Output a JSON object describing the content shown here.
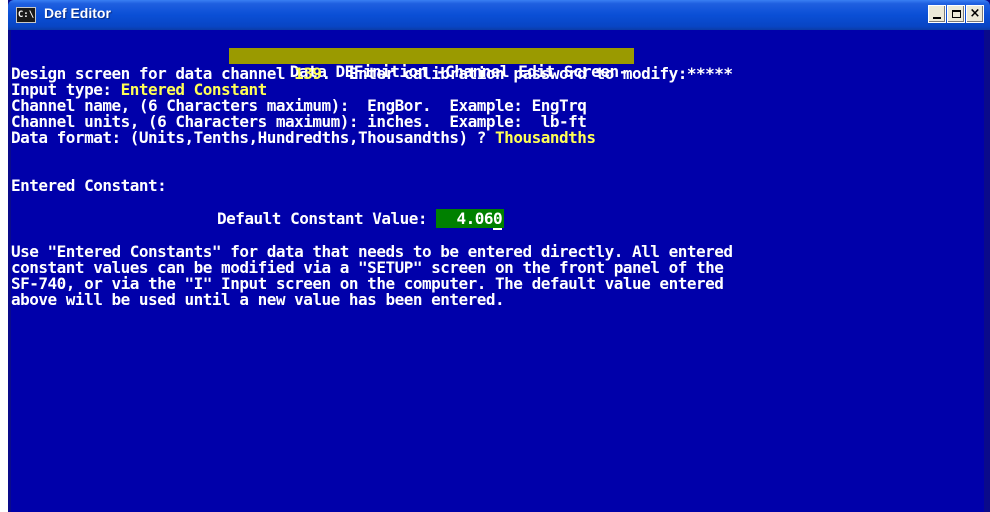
{
  "window": {
    "title": "Def Editor",
    "icon": "C:\\",
    "buttons": {
      "minimize": "minimize-icon",
      "maximize": "maximize-icon",
      "close": "close-icon"
    }
  },
  "screen": {
    "header": "Data DEFinition -Channel Edit Screen-",
    "line1_prefix": "Design screen for data channel ",
    "channel_number": "139",
    "line1_suffix": ".  Enter calibration password to modify:",
    "password_mask": "*****",
    "input_type_label": "Input type: ",
    "input_type_value": "Entered Constant",
    "channel_name_line": "Channel name, (6 Characters maximum):  EngBor.  Example: EngTrq",
    "channel_units_line": "Channel units, (6 Characters maximum): inches.  Example:  lb-ft",
    "data_format_label": "Data format: (Units,Tenths,Hundredths,Thousandths) ? ",
    "data_format_value": "Thousandths",
    "section_title": "Entered Constant:",
    "default_constant_label": "Default Constant Value: ",
    "default_constant_value": "  4.06",
    "default_constant_cursor_digit": "0",
    "help_lines": [
      "Use \"Entered Constants\" for data that needs to be entered directly. All entered",
      "constant values can be modified via a \"SETUP\" screen on the front panel of the",
      "SF-740, or via the \"I\" Input screen on the computer. The default value entered",
      "above will be used until a new value has been entered."
    ]
  },
  "colors": {
    "console_bg": "#0000aa",
    "text": "#ffffff",
    "highlight": "#ffff55",
    "header_bg": "#9a9a00",
    "value_bg": "#008000"
  }
}
